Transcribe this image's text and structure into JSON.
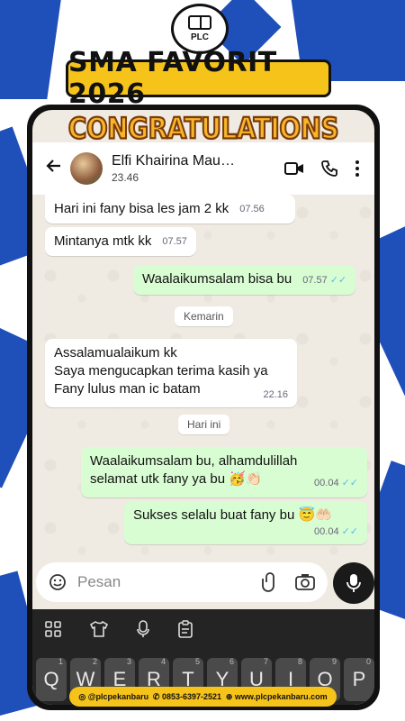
{
  "promo": {
    "logo_text": "PLC",
    "banner": "SMA FAVORIT 2026",
    "congrats": "CONGRATULATIONS",
    "footer": {
      "instagram": "@plcpekanbaru",
      "phone": "0853-6397-2521",
      "website": "www.plcpekanbaru.com"
    }
  },
  "header": {
    "contact_name": "Elfi Khairina Mau…",
    "subtitle": "23.46"
  },
  "messages": [
    {
      "dir": "in",
      "text": "Hari ini fany bisa les jam 2 kk",
      "time": "07.56"
    },
    {
      "dir": "in",
      "text": "Mintanya mtk kk",
      "time": "07.57"
    },
    {
      "dir": "out",
      "text": "Waalaikumsalam bisa bu",
      "time": "07.57"
    },
    {
      "dir": "in",
      "line1": "Assalamualaikum kk",
      "line2": "Saya mengucapkan terima kasih ya",
      "line3": "Fany lulus man ic batam",
      "time": "22.16"
    },
    {
      "dir": "out",
      "line1": "Waalaikumsalam bu, alhamdulillah",
      "line2": "selamat utk fany ya bu 🥳👏🏻",
      "time": "00.04"
    },
    {
      "dir": "out",
      "text": "Sukses selalu buat fany bu 😇🤲🏻",
      "time": "00.04"
    }
  ],
  "dividers": {
    "yesterday": "Kemarin",
    "today": "Hari ini"
  },
  "input": {
    "placeholder": "Pesan"
  },
  "keyboard": {
    "row1": [
      "Q",
      "W",
      "E",
      "R",
      "T",
      "Y",
      "U",
      "I",
      "O",
      "P"
    ],
    "nums": [
      "1",
      "2",
      "3",
      "4",
      "5",
      "6",
      "7",
      "8",
      "9",
      "0"
    ]
  },
  "colors": {
    "stripe_blue": "#1f4fb8",
    "banner_yellow": "#f6c31a",
    "outgoing_bubble": "#d9fdd3",
    "chat_bg": "#efeae2"
  }
}
